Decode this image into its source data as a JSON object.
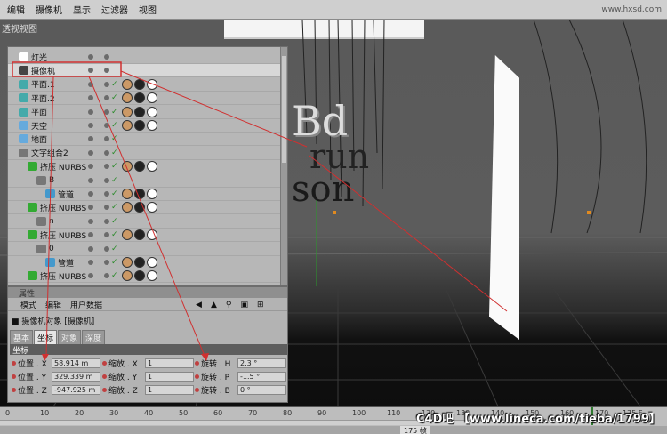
{
  "menu": [
    "编辑",
    "摄像机",
    "显示",
    "过滤器",
    "视图"
  ],
  "site_watermark": "www.hxsd.com",
  "viewport": {
    "label": "透视视图"
  },
  "objects": [
    {
      "name": "灯光",
      "type": "light"
    },
    {
      "name": "摄像机",
      "type": "camera",
      "selected": true
    },
    {
      "name": "平面.1",
      "type": "plane"
    },
    {
      "name": "平面.2",
      "type": "plane"
    },
    {
      "name": "平面",
      "type": "plane"
    },
    {
      "name": "天空",
      "type": "sky"
    },
    {
      "name": "地面",
      "type": "floor"
    },
    {
      "name": "文字组合2",
      "type": "null"
    },
    {
      "name": "挤压 NURBS",
      "type": "extrude"
    },
    {
      "name": "B",
      "type": "null"
    },
    {
      "name": "管道",
      "type": "sweep"
    },
    {
      "name": "挤压 NURBS",
      "type": "extrude"
    },
    {
      "name": "n",
      "type": "null"
    },
    {
      "name": "挤压 NURBS",
      "type": "extrude"
    },
    {
      "name": "0",
      "type": "null"
    },
    {
      "name": "管道",
      "type": "sweep"
    },
    {
      "name": "挤压 NURBS",
      "type": "extrude"
    }
  ],
  "attributes": {
    "header": "属性",
    "menu": [
      "模式",
      "编辑",
      "用户数据"
    ],
    "object_label": "摄像机对象 [摄像机]",
    "tabs": [
      "基本",
      "坐标",
      "对象",
      "深度"
    ],
    "section": "坐标",
    "rows": [
      {
        "pos_label": "位置 . X",
        "pos": "58.914 m",
        "scale_label": "缩放 . X",
        "scale": "1",
        "rot_label": "旋转 . H",
        "rot": "2.3 °"
      },
      {
        "pos_label": "位置 . Y",
        "pos": "329.339 m",
        "scale_label": "缩放 . Y",
        "scale": "1",
        "rot_label": "旋转 . P",
        "rot": "-1.5 °"
      },
      {
        "pos_label": "位置 . Z",
        "pos": "-947.925 m",
        "scale_label": "缩放 . Z",
        "scale": "1",
        "rot_label": "旋转 . B",
        "rot": "0 °"
      }
    ]
  },
  "timeline": {
    "ticks": [
      "0",
      "10",
      "20",
      "30",
      "40",
      "50",
      "60",
      "70",
      "80",
      "90",
      "100",
      "110",
      "120",
      "130",
      "140",
      "150",
      "160",
      "170",
      "175 F"
    ],
    "current_frame": "175 帧"
  },
  "forum_watermark": "C4D吧 【www.lineca.com/tieba/1799】",
  "text_sculpture": [
    "Bd",
    "run",
    "son"
  ],
  "colors": {
    "selection_red": "#d03030",
    "panel_bg": "#b7b7b7"
  }
}
